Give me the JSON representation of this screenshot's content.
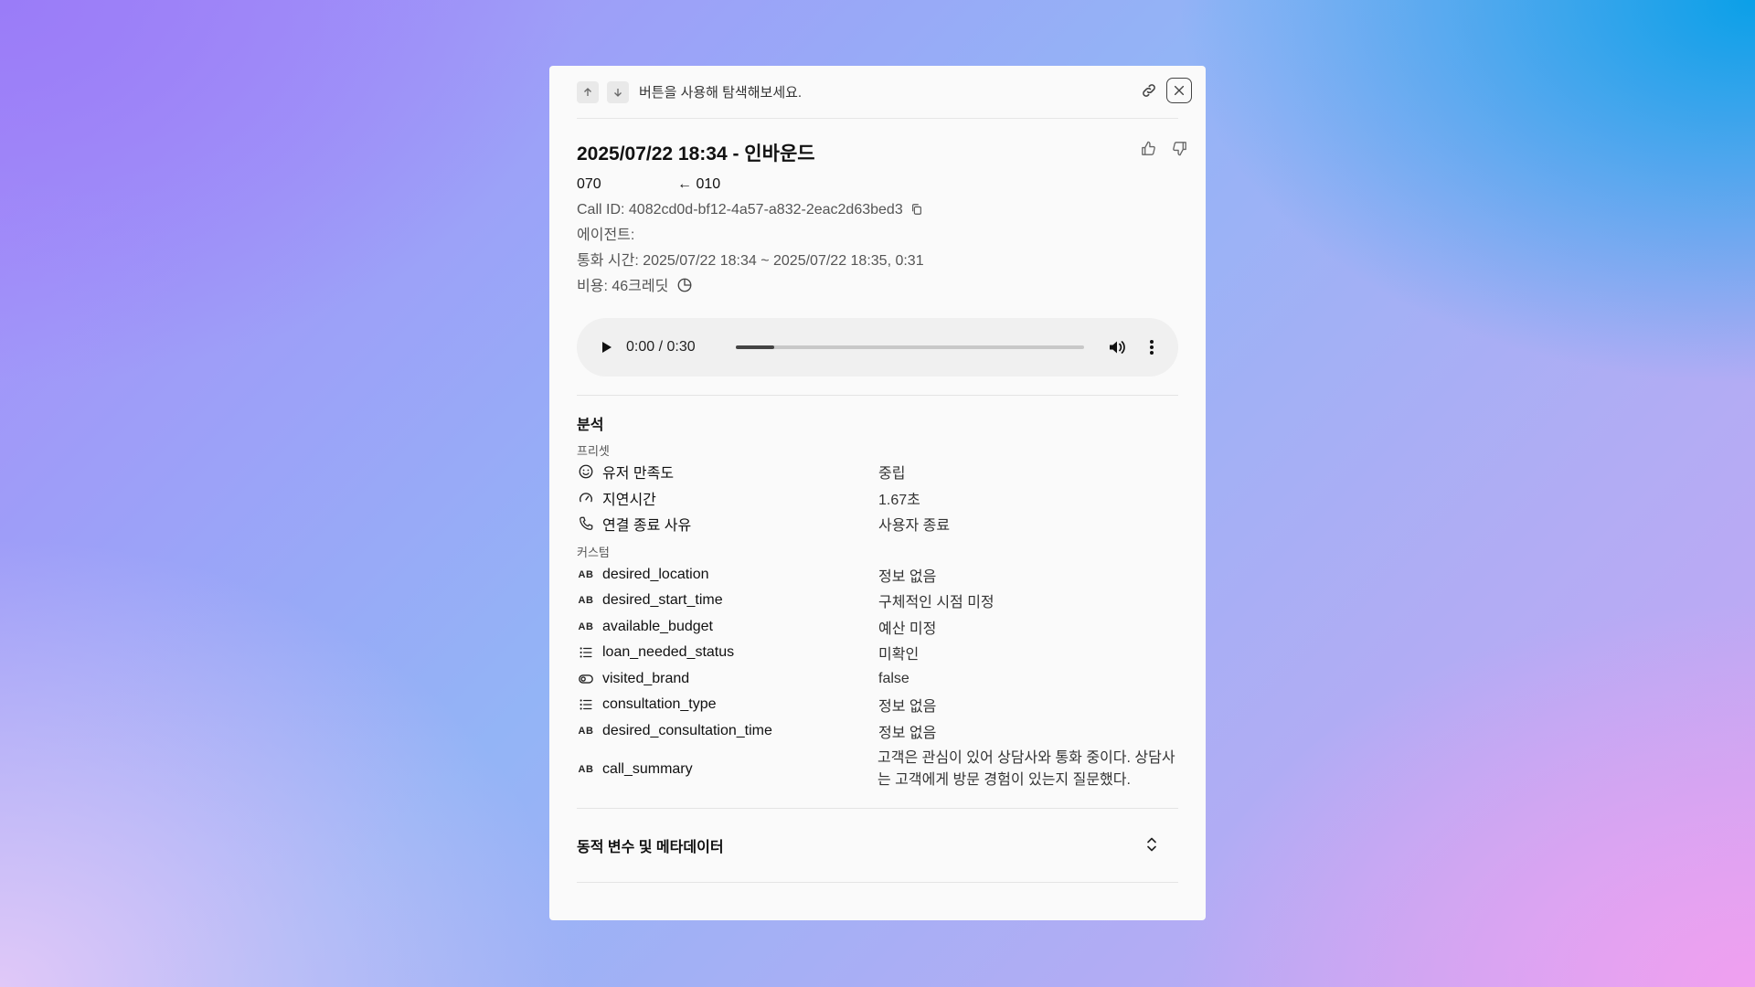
{
  "header": {
    "hint": "버튼을 사용해 탐색해보세요."
  },
  "call": {
    "title": "2025/07/22 18:34 - 인바운드",
    "to_number": "070",
    "from_number": "← 010",
    "call_id": "Call ID: 4082cd0d-bf12-4a57-a832-2eac2d63bed3",
    "agent": "에이전트:",
    "duration": "통화 시간: 2025/07/22 18:34 ~ 2025/07/22 18:35, 0:31",
    "cost": "비용: 46크레딧"
  },
  "player": {
    "time": "0:00 / 0:30",
    "progress": 0.11
  },
  "analysis": {
    "title": "분석",
    "preset_label": "프리셋",
    "preset": [
      {
        "icon": "smile-icon",
        "label": "유저 만족도",
        "value": "중립"
      },
      {
        "icon": "gauge-icon",
        "label": "지연시간",
        "value": "1.67초"
      },
      {
        "icon": "phone-icon",
        "label": "연결 종료 사유",
        "value": "사용자 종료"
      }
    ],
    "custom_label": "커스텀",
    "custom": [
      {
        "icon": "text-type-icon",
        "label": "desired_location",
        "value": "정보 없음"
      },
      {
        "icon": "text-type-icon",
        "label": "desired_start_time",
        "value": "구체적인 시점 미정"
      },
      {
        "icon": "text-type-icon",
        "label": "available_budget",
        "value": "예산 미정"
      },
      {
        "icon": "list-icon",
        "label": "loan_needed_status",
        "value": "미확인"
      },
      {
        "icon": "toggle-icon",
        "label": "visited_brand",
        "value": "false"
      },
      {
        "icon": "list-icon",
        "label": "consultation_type",
        "value": "정보 없음"
      },
      {
        "icon": "text-type-icon",
        "label": "desired_consultation_time",
        "value": "정보 없음"
      }
    ],
    "summary": {
      "icon": "text-type-icon",
      "label": "call_summary",
      "value": "고객은 관심이 있어 상담사와 통화 중이다. 상담사는 고객에게 방문 경험이 있는지 질문했다."
    },
    "ab_glyph": "AB"
  },
  "metadata": {
    "title": "동적 변수 및 메타데이터"
  }
}
